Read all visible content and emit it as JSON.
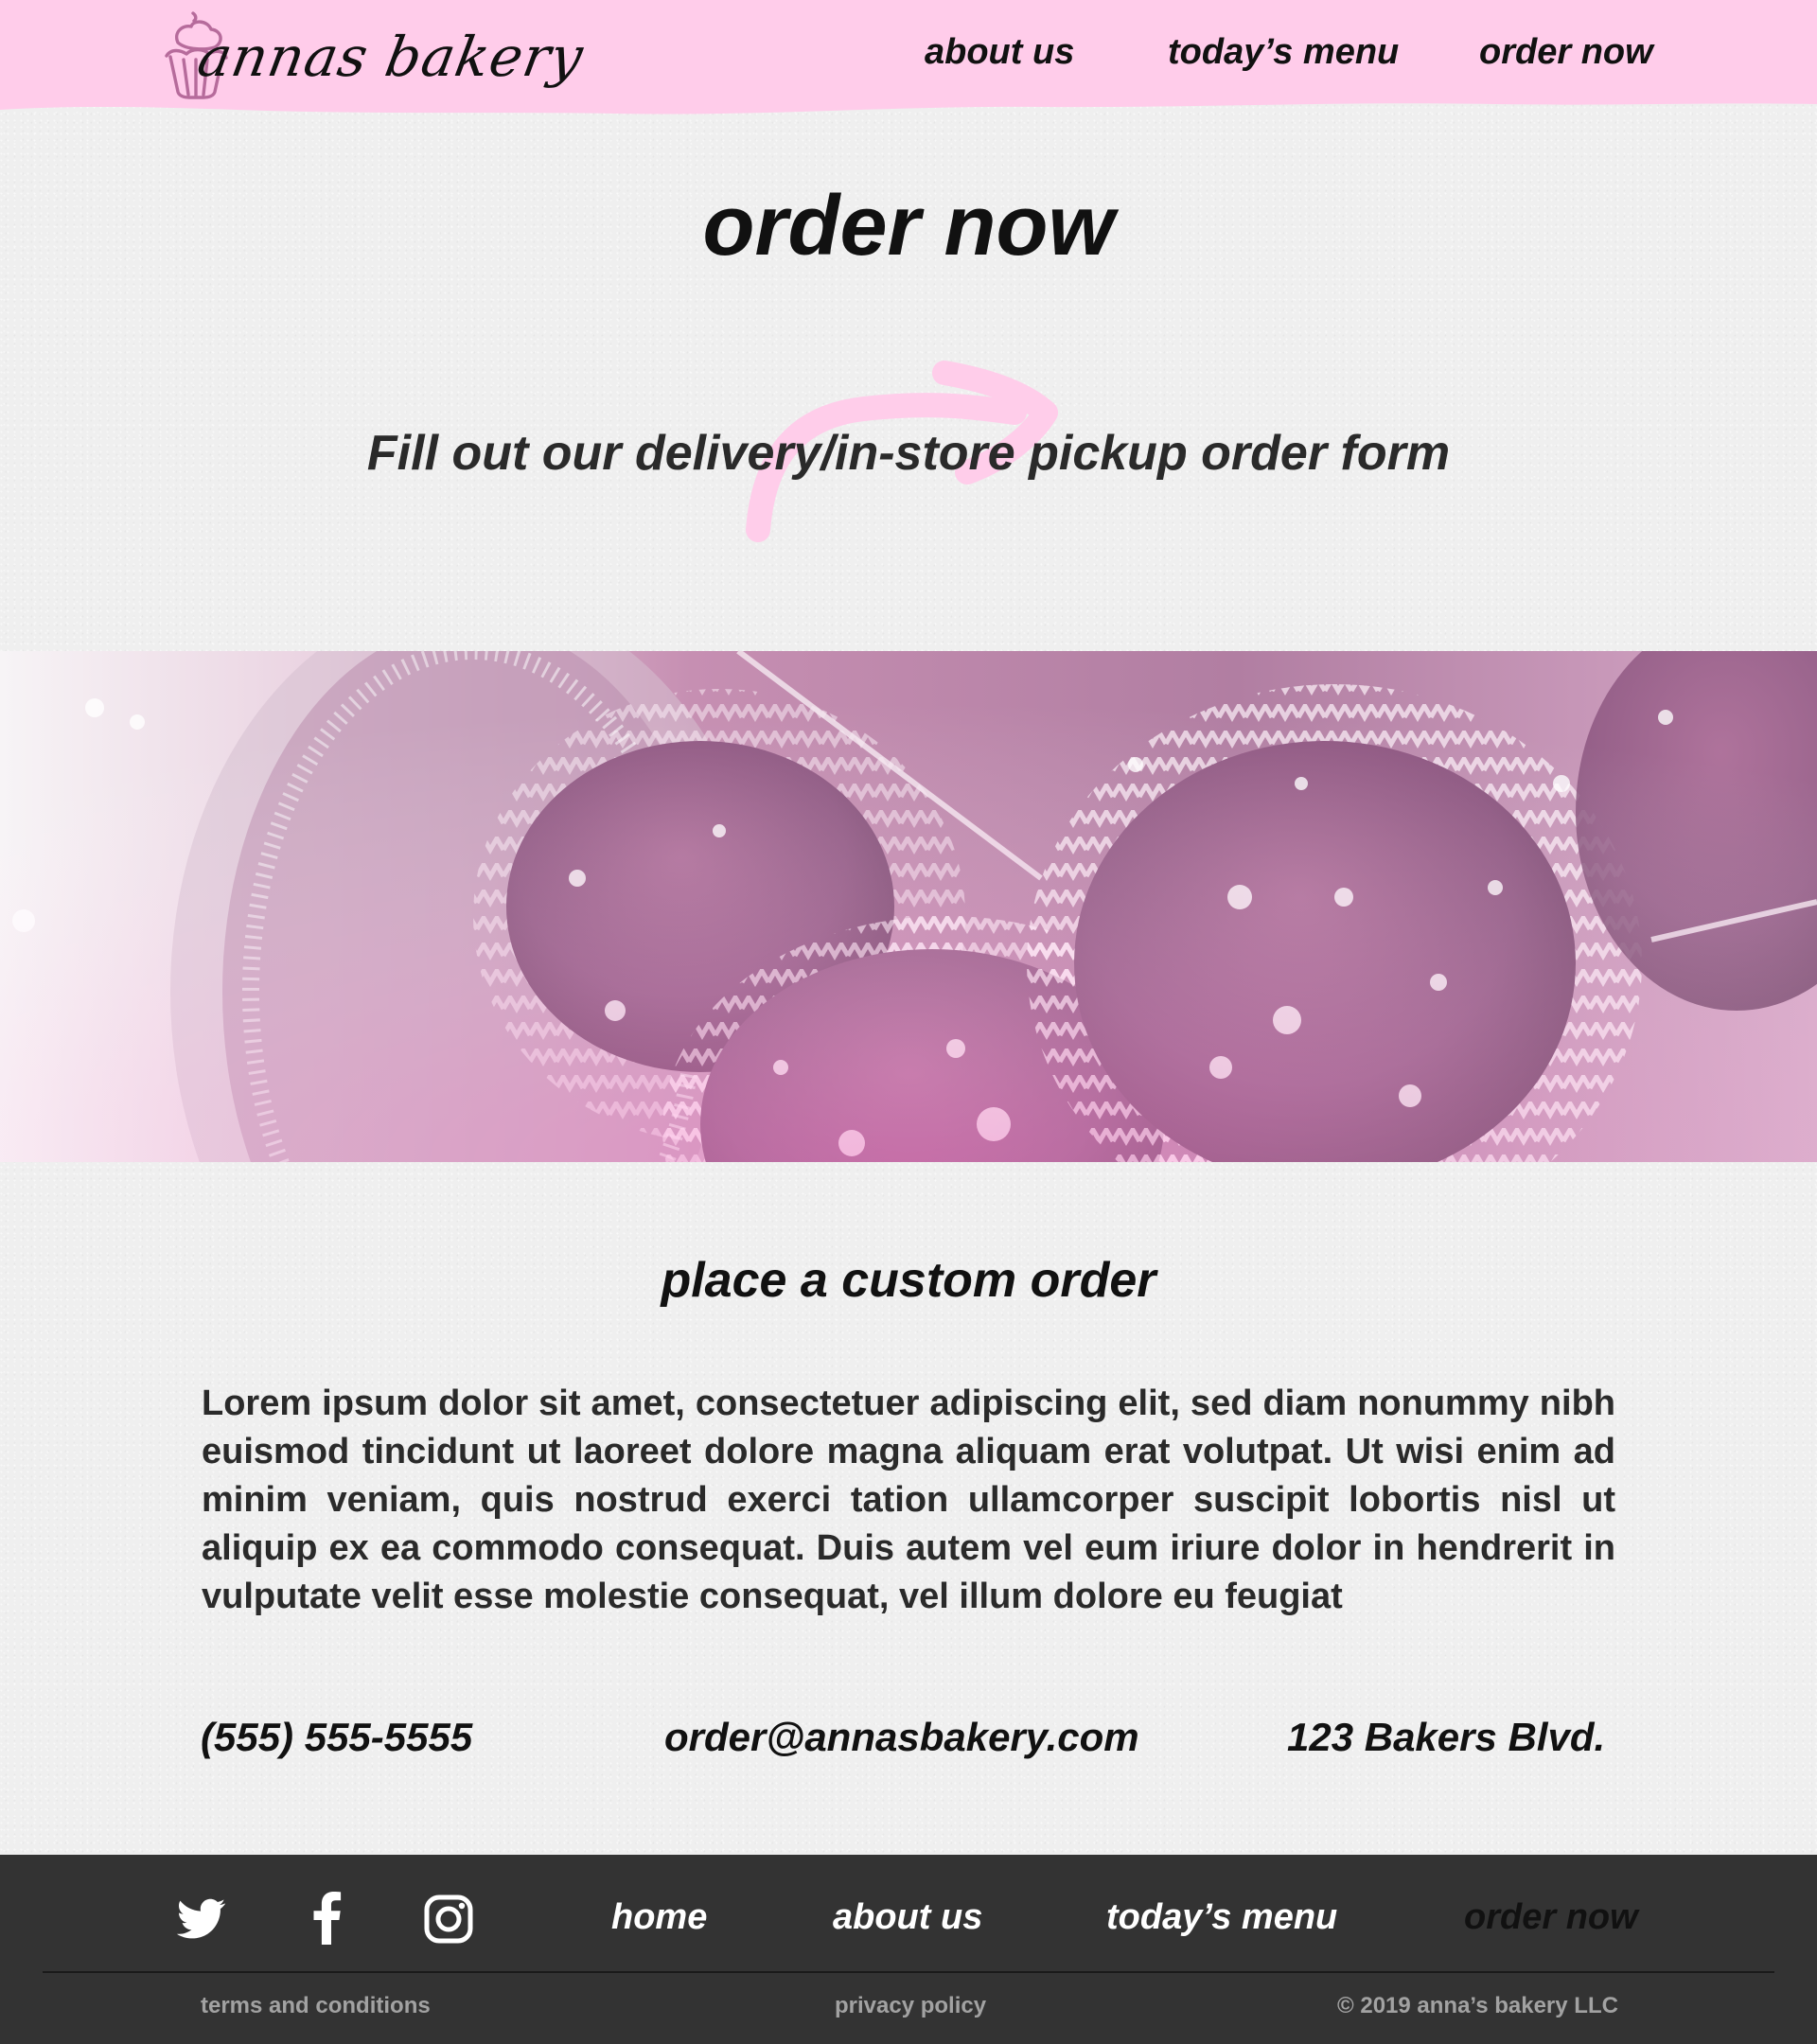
{
  "brand": {
    "logo_text": "annas bakery",
    "accent_color": "#ffccea",
    "footer_color": "#333333"
  },
  "header": {
    "nav": [
      {
        "label": "about us"
      },
      {
        "label": "today’s menu"
      },
      {
        "label": "order now"
      }
    ]
  },
  "hero": {
    "title": "order now",
    "form_link": "Fill out our delivery/in-store pickup order form"
  },
  "custom_order": {
    "title": "place a custom order",
    "body": "Lorem ipsum dolor sit amet, consectetuer adipiscing elit, sed diam nonummy nibh euismod tincidunt ut laoreet dolore magna aliquam erat volutpat. Ut wisi enim ad minim veniam, quis nostrud exerci tation ullamcorper suscipit lobortis nisl ut aliquip ex ea commodo consequat. Duis autem vel eum iriure dolor in hendrerit in vulputate velit esse molestie consequat, vel illum dolore eu feugiat",
    "phone": "(555) 555-5555",
    "email": "order@annasbakery.com",
    "address": "123 Bakers Blvd."
  },
  "footer": {
    "social": [
      "twitter-icon",
      "facebook-icon",
      "instagram-icon"
    ],
    "nav": [
      {
        "label": "home"
      },
      {
        "label": "about us"
      },
      {
        "label": "today’s menu"
      },
      {
        "label": "order now"
      }
    ],
    "terms": "terms and conditions",
    "privacy": "privacy policy",
    "copyright": "© 2019 anna’s bakery LLC"
  }
}
